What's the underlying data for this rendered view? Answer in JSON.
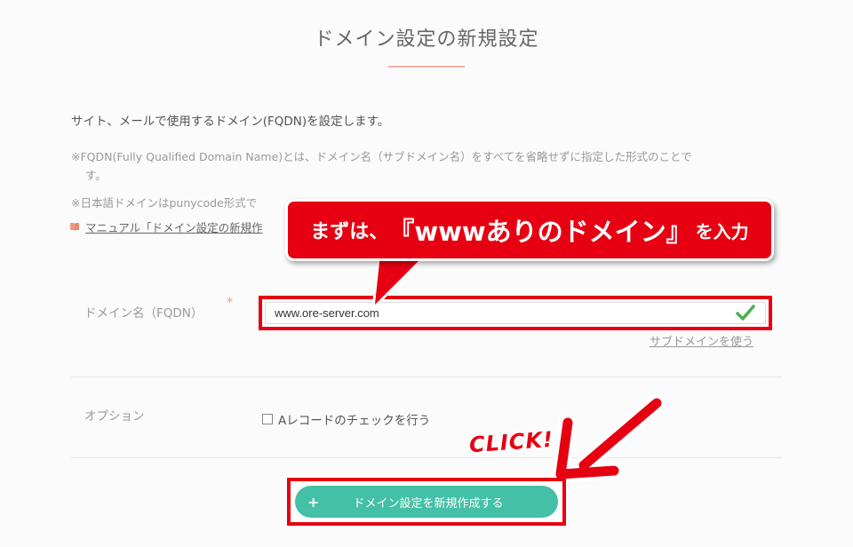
{
  "page": {
    "title": "ドメイン設定の新規設定",
    "lead": "サイト、メールで使用するドメイン(FQDN)を設定します。",
    "note1_a": "※FQDN(Fully Qualified Domain Name)とは、ドメイン名（サブドメイン名）をすべてを省略せずに指定した形式のことで",
    "note1_b": "す。",
    "note2": "※日本語ドメインはpunycode形式で",
    "manual_link": "マニュアル「ドメイン設定の新規作"
  },
  "callout": {
    "pre": "まずは、",
    "big": "『wwwありのドメイン』",
    "post": "を入力"
  },
  "form": {
    "domain_label": "ドメイン名（FQDN）",
    "required_mark": "*",
    "domain_value": "www.ore-server.com",
    "subdomain_link": "サブドメインを使う",
    "option_label": "オプション",
    "option_checkbox_label": "Aレコードのチェックを行う",
    "option_checked": false
  },
  "annotation": {
    "click_text": "CLICK!"
  },
  "submit": {
    "icon": "plus-icon",
    "label": "ドメイン設定を新規作成する"
  },
  "colors": {
    "accent_red": "#e60012",
    "button_green": "#43c0a5",
    "check_green": "#4caf50",
    "title_rule": "#f2b3a4"
  }
}
